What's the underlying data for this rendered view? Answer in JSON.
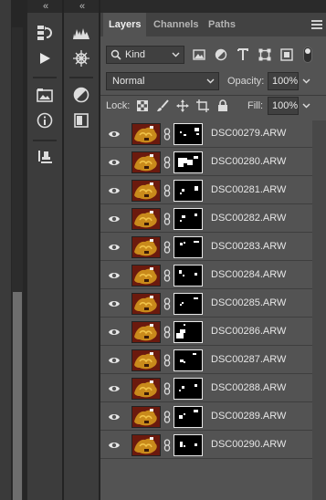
{
  "columns": {
    "collapse_glyph": "«"
  },
  "tools_col1": [
    {
      "name": "history-icon"
    },
    {
      "name": "play-icon"
    },
    {
      "name": "folder-image-icon"
    },
    {
      "name": "info-icon"
    },
    {
      "name": "clone-stamp-icon"
    }
  ],
  "tools_col2": [
    {
      "name": "histogram-icon"
    },
    {
      "name": "navigator-icon"
    },
    {
      "name": "adjustments-icon"
    },
    {
      "name": "styles-icon"
    }
  ],
  "tabs": [
    {
      "label": "Layers",
      "active": true
    },
    {
      "label": "Channels",
      "active": false
    },
    {
      "label": "Paths",
      "active": false
    }
  ],
  "filter": {
    "kind_label": "Kind",
    "icons": [
      "image-filter-icon",
      "adjustment-filter-icon",
      "type-filter-icon",
      "shape-filter-icon",
      "smart-object-filter-icon"
    ]
  },
  "blend_mode": "Normal",
  "opacity": {
    "label": "Opacity:",
    "value": "100%"
  },
  "lock": {
    "label": "Lock:",
    "icons": [
      "lock-transparent-icon",
      "lock-paint-icon",
      "lock-position-icon",
      "lock-artboard-icon",
      "lock-all-icon"
    ]
  },
  "fill": {
    "label": "Fill:",
    "value": "100%"
  },
  "layers": [
    {
      "name": "DSC00279.ARW"
    },
    {
      "name": "DSC00280.ARW"
    },
    {
      "name": "DSC00281.ARW"
    },
    {
      "name": "DSC00282.ARW"
    },
    {
      "name": "DSC00283.ARW"
    },
    {
      "name": "DSC00284.ARW"
    },
    {
      "name": "DSC00285.ARW"
    },
    {
      "name": "DSC00286.ARW"
    },
    {
      "name": "DSC00287.ARW"
    },
    {
      "name": "DSC00288.ARW"
    },
    {
      "name": "DSC00289.ARW"
    },
    {
      "name": "DSC00290.ARW"
    }
  ],
  "colors": {
    "panel": "#535353",
    "dark": "#3c3c3c",
    "text": "#e6e6e6"
  }
}
